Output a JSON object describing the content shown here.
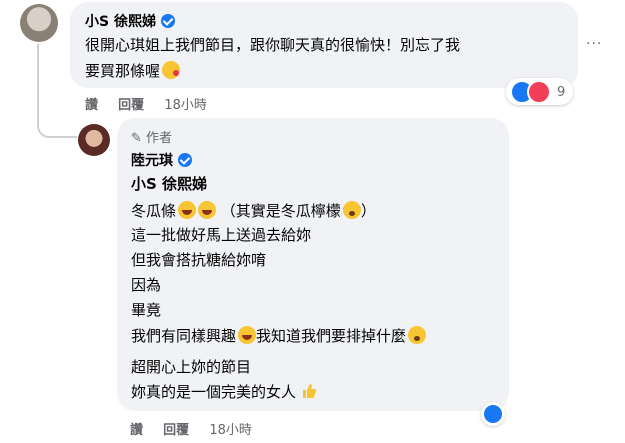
{
  "comment": {
    "author": "小S 徐熙娣",
    "text_line1": "很開心琪姐上我們節目，跟你聊天真的很愉快！別忘了我",
    "text_line2": "要買那條喔",
    "actions": {
      "like": "讚",
      "reply": "回覆",
      "time": "18小時"
    },
    "reactions": {
      "count": "9"
    },
    "more_label": "···"
  },
  "reply": {
    "badge_label": "作者",
    "author": "陸元琪",
    "mention": "小S 徐熙娣",
    "lines": [
      "冬瓜條",
      "（其實是冬瓜檸檬",
      "）",
      "這一批做好馬上送過去給妳",
      "但我會搭抗糖給妳唷",
      "因為",
      "畢竟",
      "我們有同樣興趣",
      "我知道我們要排掉什麼",
      "超開心上妳的節目",
      "妳真的是一個完美的女人"
    ],
    "actions": {
      "like": "讚",
      "reply": "回覆",
      "time": "18小時"
    }
  },
  "colors": {
    "bubble": "#f0f2f5",
    "accent": "#1877f2",
    "meta": "#65676b"
  }
}
